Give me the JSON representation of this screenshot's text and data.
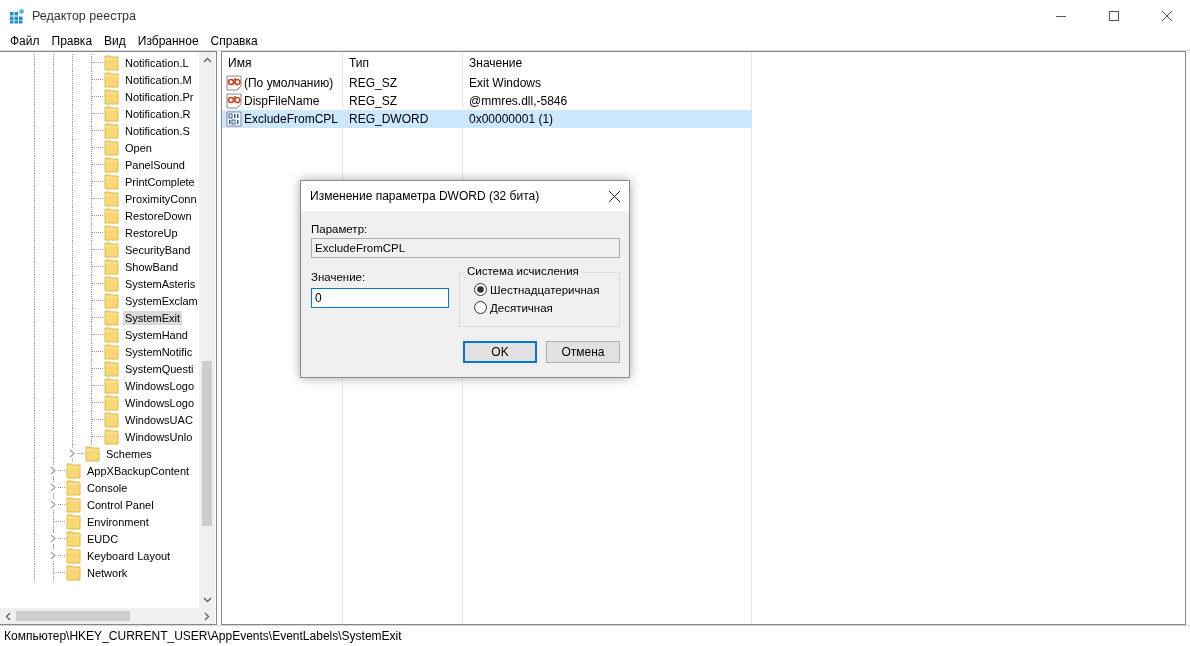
{
  "window": {
    "title": "Редактор реестра"
  },
  "menu": [
    "Файл",
    "Правка",
    "Вид",
    "Избранное",
    "Справка"
  ],
  "tree": {
    "items": [
      {
        "children": [
          {
            "children": [
              {
                "label": "Notification.L",
                "expandable": false,
                "selected": false
              },
              {
                "label": "Notification.M",
                "expandable": false,
                "selected": false
              },
              {
                "label": "Notification.Pr",
                "expandable": false,
                "selected": false
              },
              {
                "label": "Notification.R",
                "expandable": false,
                "selected": false
              },
              {
                "label": "Notification.S",
                "expandable": false,
                "selected": false
              },
              {
                "label": "Open",
                "expandable": false,
                "selected": false
              },
              {
                "label": "PanelSound",
                "expandable": false,
                "selected": false
              },
              {
                "label": "PrintComplete",
                "expandable": false,
                "selected": false
              },
              {
                "label": "ProximityConn",
                "expandable": false,
                "selected": false
              },
              {
                "label": "RestoreDown",
                "expandable": false,
                "selected": false
              },
              {
                "label": "RestoreUp",
                "expandable": false,
                "selected": false
              },
              {
                "label": "SecurityBand",
                "expandable": false,
                "selected": false
              },
              {
                "label": "ShowBand",
                "expandable": false,
                "selected": false
              },
              {
                "label": "SystemAsteris",
                "expandable": false,
                "selected": false
              },
              {
                "label": "SystemExclam",
                "expandable": false,
                "selected": false
              },
              {
                "label": "SystemExit",
                "expandable": false,
                "selected": true
              },
              {
                "label": "SystemHand",
                "expandable": false,
                "selected": false
              },
              {
                "label": "SystemNotific",
                "expandable": false,
                "selected": false
              },
              {
                "label": "SystemQuesti",
                "expandable": false,
                "selected": false
              },
              {
                "label": "WindowsLogo",
                "expandable": false,
                "selected": false
              },
              {
                "label": "WindowsLogo",
                "expandable": false,
                "selected": false
              },
              {
                "label": "WindowsUAC",
                "expandable": false,
                "selected": false
              },
              {
                "label": "WindowsUnlo",
                "expandable": false,
                "selected": false
              }
            ]
          },
          {
            "label": "Schemes",
            "expandable": true,
            "selected": false
          }
        ]
      },
      {
        "label": "AppXBackupContent",
        "expandable": true,
        "selected": false
      },
      {
        "label": "Console",
        "expandable": true,
        "selected": false
      },
      {
        "label": "Control Panel",
        "expandable": true,
        "selected": false
      },
      {
        "label": "Environment",
        "expandable": false,
        "selected": false
      },
      {
        "label": "EUDC",
        "expandable": true,
        "selected": false
      },
      {
        "label": "Keyboard Layout",
        "expandable": true,
        "selected": false
      },
      {
        "label": "Network",
        "expandable": false,
        "selected": false
      }
    ]
  },
  "values_table": {
    "columns": [
      "Имя",
      "Тип",
      "Значение"
    ],
    "rows": [
      {
        "kind": "string",
        "name": "(По умолчанию)",
        "type": "REG_SZ",
        "data": "Exit Windows",
        "selected": false
      },
      {
        "kind": "string",
        "name": "DispFileName",
        "type": "REG_SZ",
        "data": "@mmres.dll,-5846",
        "selected": false
      },
      {
        "kind": "dword",
        "name": "ExcludeFromCPL",
        "type": "REG_DWORD",
        "data": "0x00000001 (1)",
        "selected": true
      }
    ]
  },
  "dialog": {
    "title": "Изменение параметра DWORD (32 бита)",
    "name_label": "Параметр:",
    "name_value": "ExcludeFromCPL",
    "value_label": "Значение:",
    "value": "0",
    "base_group": "Система исчисления",
    "bases": [
      {
        "label": "Шестнадцатеричная",
        "selected": true
      },
      {
        "label": "Десятичная",
        "selected": false
      }
    ],
    "ok": "OK",
    "cancel": "Отмена"
  },
  "status_bar": "Компьютер\\HKEY_CURRENT_USER\\AppEvents\\EventLabels\\SystemExit"
}
